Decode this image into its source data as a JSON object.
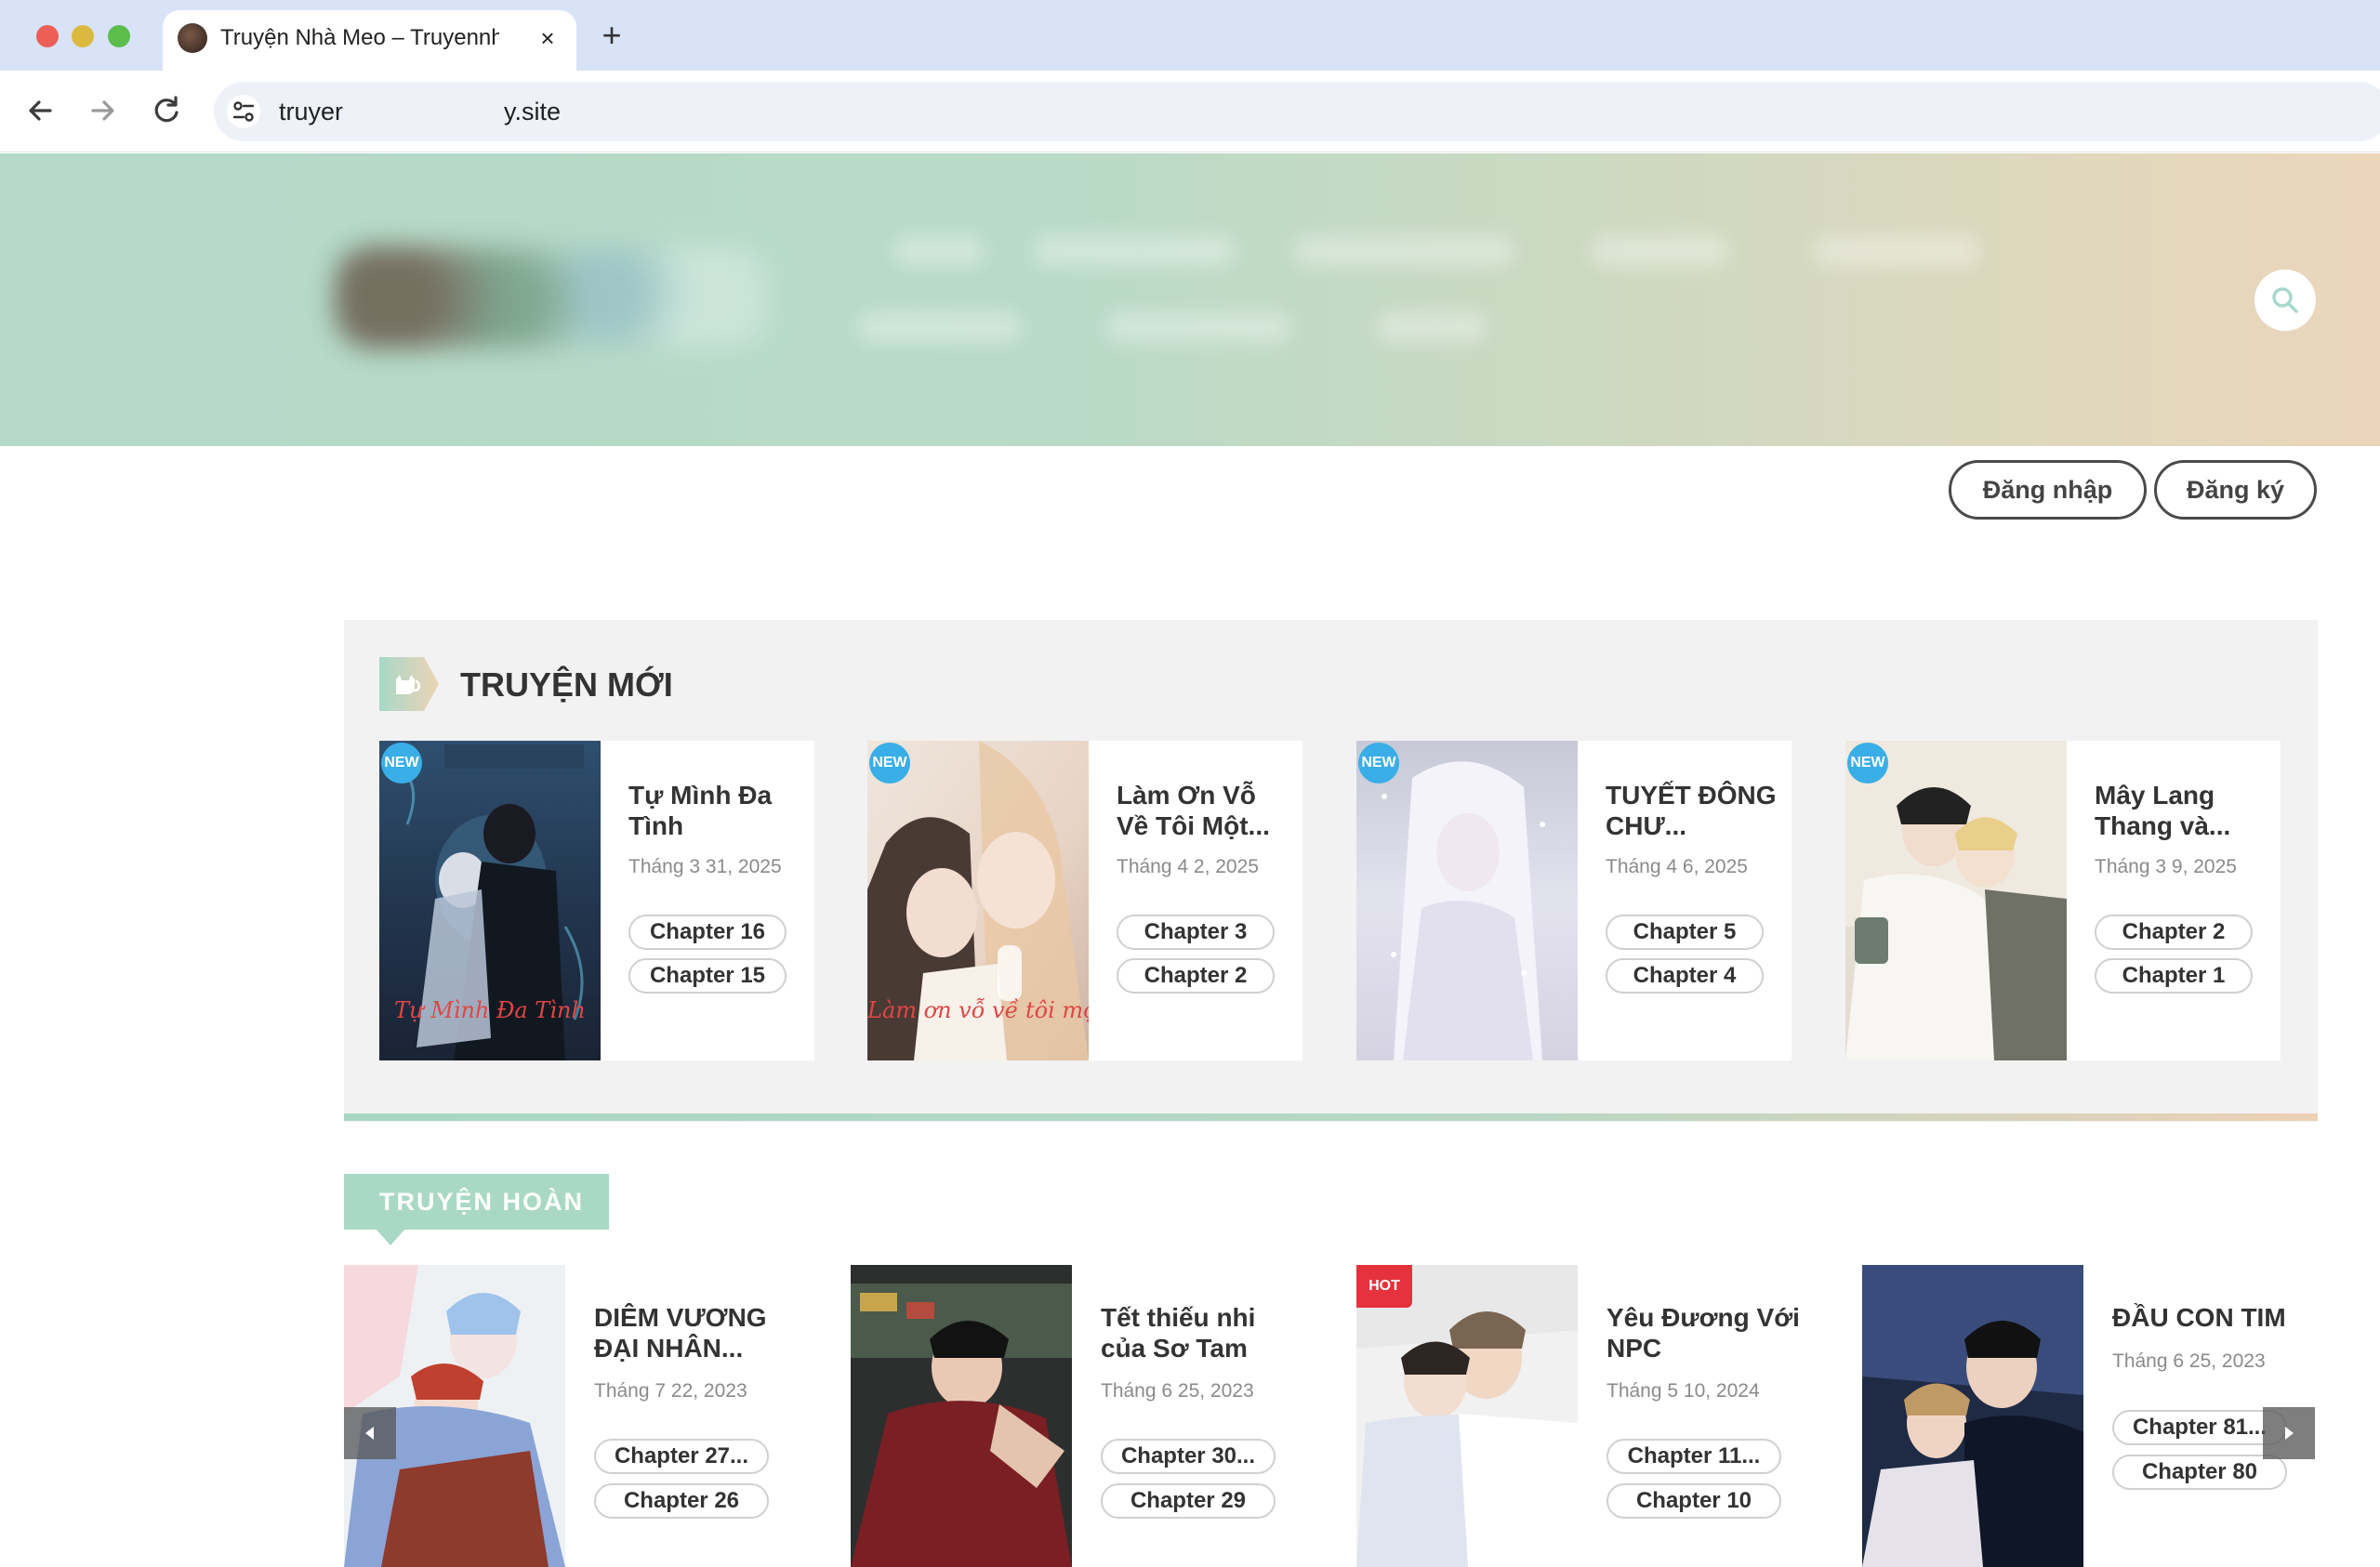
{
  "browser": {
    "tab_title": "Truyện Nhà Meo – Truyennhameo",
    "tab_close_icon": "×",
    "new_tab_icon": "+",
    "url_start": "truyer",
    "url_end": "y.site"
  },
  "header": {
    "login_label": "Đăng nhập",
    "register_label": "Đăng ký"
  },
  "new_section": {
    "title": "TRUYỆN MỚI",
    "items": [
      {
        "title": "Tự Mình Đa Tình",
        "date": "Tháng 3 31, 2025",
        "badge": "NEW",
        "cover_text": "Tự Mình Đa Tình",
        "chapters": [
          "Chapter 16",
          "Chapter 15"
        ]
      },
      {
        "title": "Làm Ơn Vỗ Về Tôi Một...",
        "date": "Tháng 4 2, 2025",
        "badge": "NEW",
        "cover_text": "Làm ơn vỗ về tôi một chút",
        "chapters": [
          "Chapter 3",
          "Chapter 2"
        ]
      },
      {
        "title": "TUYẾT ĐÔNG CHƯ...",
        "date": "Tháng 4 6, 2025",
        "badge": "NEW",
        "cover_text": "",
        "chapters": [
          "Chapter 5",
          "Chapter 4"
        ]
      },
      {
        "title": "Mây Lang Thang và...",
        "date": "Tháng 3 9, 2025",
        "badge": "NEW",
        "cover_text": "",
        "chapters": [
          "Chapter 2",
          "Chapter 1"
        ]
      }
    ]
  },
  "complete_section": {
    "title": "TRUYỆN HOÀN",
    "items": [
      {
        "title": "DIÊM VƯƠNG ĐẠI NHÂN...",
        "date": "Tháng 7 22, 2023",
        "chapters": [
          "Chapter 27...",
          "Chapter 26"
        ]
      },
      {
        "title": "Tết thiếu nhi của Sơ Tam",
        "date": "Tháng 6 25, 2023",
        "chapters": [
          "Chapter 30...",
          "Chapter 29"
        ]
      },
      {
        "title": "Yêu Đương Với NPC",
        "date": "Tháng 5 10, 2024",
        "badge": "HOT",
        "chapters": [
          "Chapter 11...",
          "Chapter 10"
        ]
      },
      {
        "title": "ĐẦU CON TIM",
        "date": "Tháng 6 25, 2023",
        "chapters": [
          "Chapter 81...",
          "Chapter 80"
        ]
      }
    ]
  },
  "icons": {
    "back": "arrow-left-icon",
    "forward": "arrow-right-icon",
    "reload": "reload-icon",
    "site_info": "tune-icon",
    "search": "search-icon",
    "section": "cat-icon",
    "slider_prev": "caret-left-icon",
    "slider_next": "caret-right-icon"
  },
  "colors": {
    "header_gradient_start": "#b4d9c8",
    "header_gradient_end": "#ecd6bb",
    "new_badge": "#3aaee6",
    "hot_badge": "#e5323d",
    "section_tag": "#a9d8c5"
  }
}
